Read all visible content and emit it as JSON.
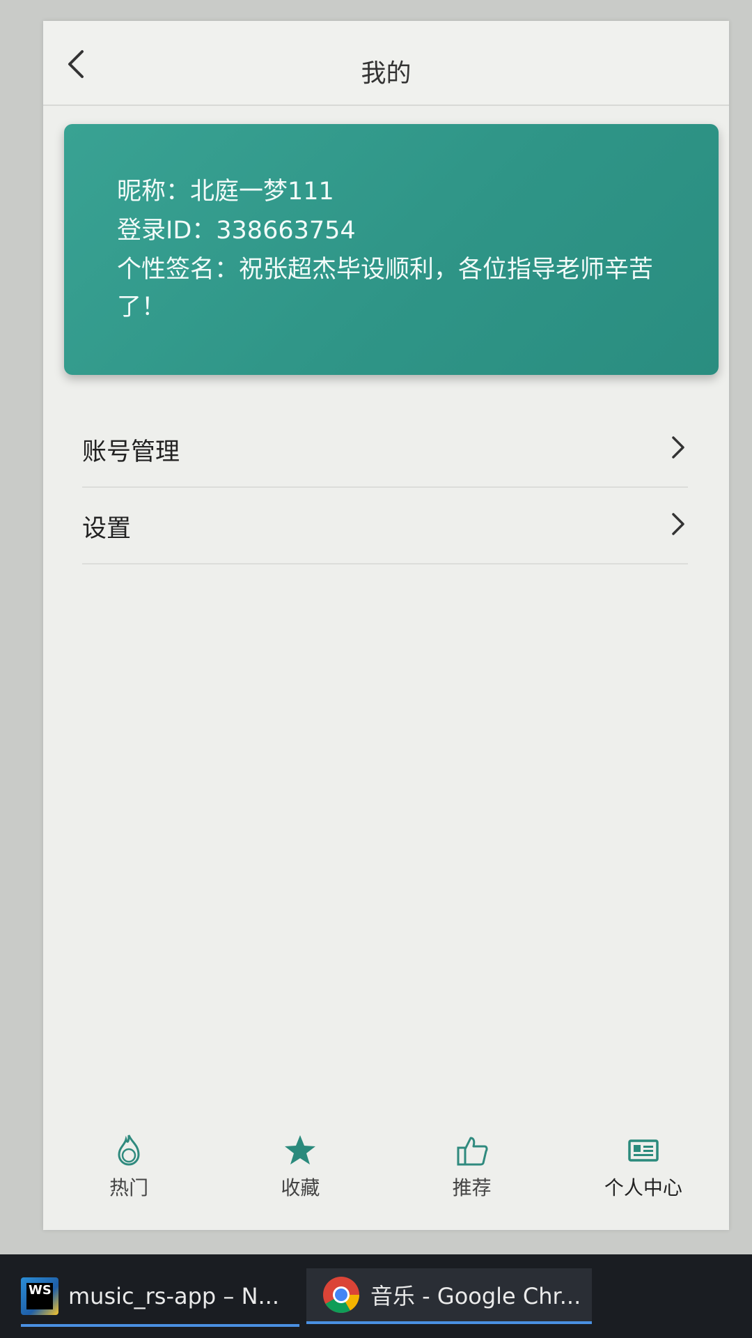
{
  "header": {
    "title": "我的"
  },
  "profile": {
    "nickname_line": "昵称：北庭一梦111",
    "login_id_line": "登录ID：338663754",
    "signature_line": "个性签名：祝张超杰毕设顺利，各位指导老师辛苦了！"
  },
  "menu": {
    "items": [
      {
        "label": "账号管理"
      },
      {
        "label": "设置"
      }
    ]
  },
  "tabbar": {
    "items": [
      {
        "label": "热门",
        "icon": "hot-icon"
      },
      {
        "label": "收藏",
        "icon": "star-icon"
      },
      {
        "label": "推荐",
        "icon": "thumbs-up-icon"
      },
      {
        "label": "个人中心",
        "icon": "id-card-icon"
      }
    ]
  },
  "taskbar": {
    "items": [
      {
        "label": "music_rs-app – N...",
        "icon": "webstorm-icon"
      },
      {
        "label": "音乐 - Google Chr...",
        "icon": "chrome-icon"
      }
    ]
  },
  "colors": {
    "accent": "#2f9587",
    "background": "#eeefec",
    "taskbar": "#1a1d22"
  }
}
